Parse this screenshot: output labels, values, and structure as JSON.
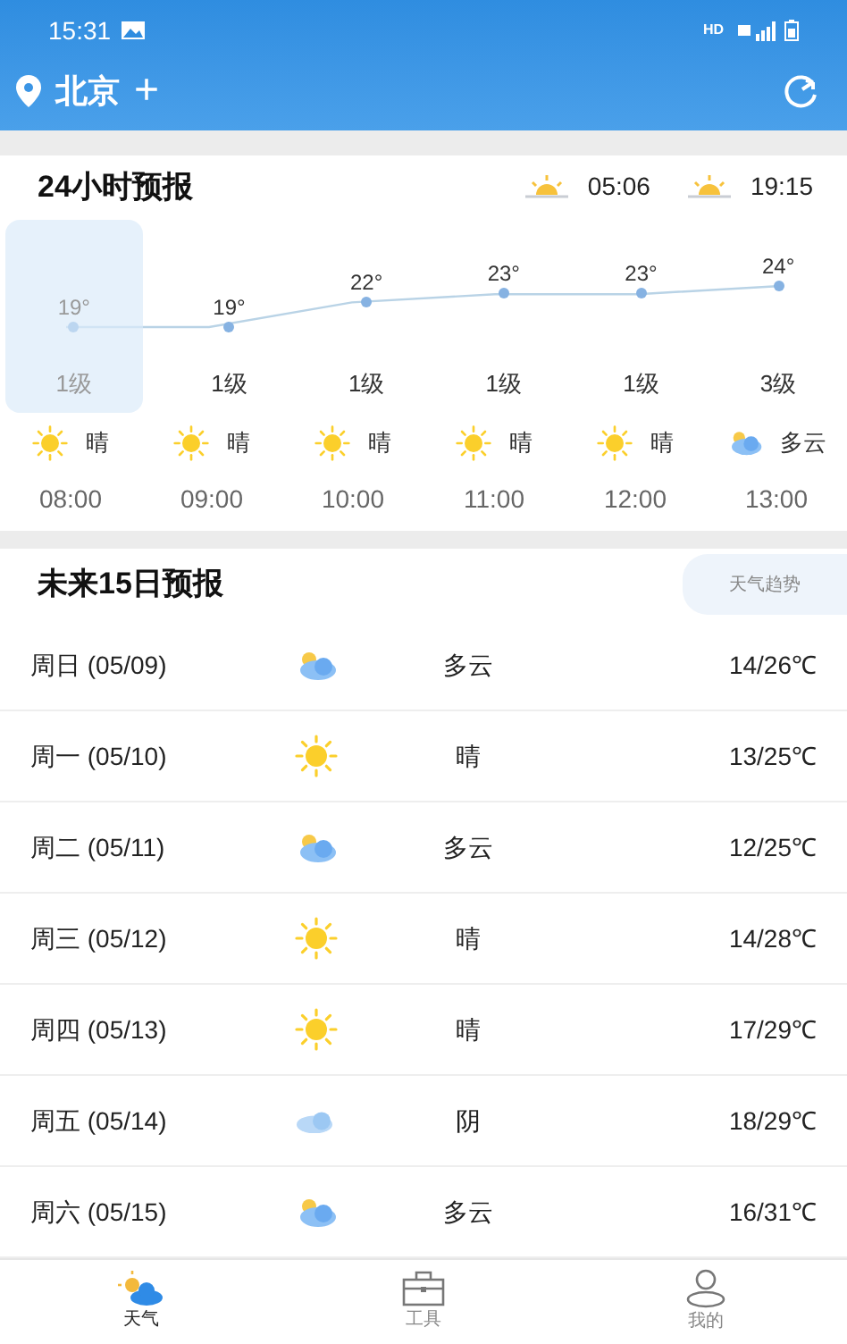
{
  "status_bar": {
    "time": "15:31",
    "network": "HD"
  },
  "header": {
    "city": "北京",
    "add": "+"
  },
  "hourly": {
    "title": "24小时预报",
    "sunrise": "05:06",
    "sunset": "19:15",
    "hours": [
      {
        "temp": "19°",
        "wind": "1级",
        "kind": "sunny",
        "weather": "晴",
        "time": "08:00",
        "selected": true
      },
      {
        "temp": "19°",
        "wind": "1级",
        "kind": "sunny",
        "weather": "晴",
        "time": "09:00",
        "selected": false
      },
      {
        "temp": "22°",
        "wind": "1级",
        "kind": "sunny",
        "weather": "晴",
        "time": "10:00",
        "selected": false
      },
      {
        "temp": "23°",
        "wind": "1级",
        "kind": "sunny",
        "weather": "晴",
        "time": "11:00",
        "selected": false
      },
      {
        "temp": "23°",
        "wind": "1级",
        "kind": "sunny",
        "weather": "晴",
        "time": "12:00",
        "selected": false
      },
      {
        "temp": "24°",
        "wind": "3级",
        "kind": "cloudy",
        "weather": "多云",
        "time": "13:00",
        "selected": false
      }
    ]
  },
  "daily": {
    "title": "未来15日预报",
    "trend_button": "天气趋势",
    "days": [
      {
        "day": "周日 (05/09)",
        "kind": "cloudy",
        "weather": "多云",
        "range": "14/26℃"
      },
      {
        "day": "周一 (05/10)",
        "kind": "sunny",
        "weather": "晴",
        "range": "13/25℃"
      },
      {
        "day": "周二 (05/11)",
        "kind": "cloudy",
        "weather": "多云",
        "range": "12/25℃"
      },
      {
        "day": "周三 (05/12)",
        "kind": "sunny",
        "weather": "晴",
        "range": "14/28℃"
      },
      {
        "day": "周四 (05/13)",
        "kind": "sunny",
        "weather": "晴",
        "range": "17/29℃"
      },
      {
        "day": "周五 (05/14)",
        "kind": "overcast",
        "weather": "阴",
        "range": "18/29℃"
      },
      {
        "day": "周六 (05/15)",
        "kind": "cloudy",
        "weather": "多云",
        "range": "16/31℃"
      }
    ]
  },
  "tabs": [
    {
      "label": "天气",
      "kind": "weather",
      "selected": true
    },
    {
      "label": "工具",
      "kind": "tools",
      "selected": false
    },
    {
      "label": "我的",
      "kind": "profile",
      "selected": false
    }
  ]
}
